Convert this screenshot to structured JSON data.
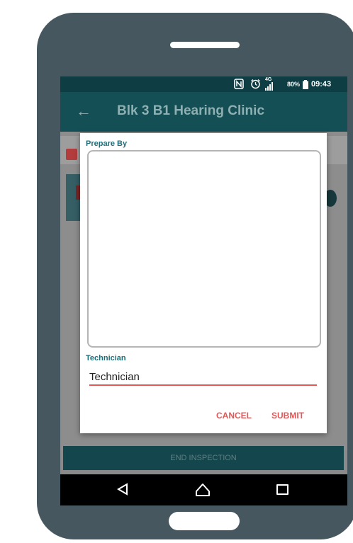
{
  "status_bar": {
    "nfc_icon": "nfc-icon",
    "alarm_icon": "alarm-icon",
    "network": "4G",
    "battery_pct": "80%",
    "time": "09:43"
  },
  "app_bar": {
    "back_glyph": "←",
    "title": "Blk 3 B1 Hearing Clinic"
  },
  "dialog": {
    "prepare_by_label": "Prepare By",
    "prepare_by_value": "",
    "technician_label": "Technician",
    "technician_value": "Technician",
    "cancel_label": "CANCEL",
    "submit_label": "SUBMIT"
  },
  "background": {
    "end_inspection_label": "END INSPECTION"
  },
  "colors": {
    "primary": "#134f55",
    "status_bar": "#0e3d43",
    "accent": "#e05858",
    "label": "#1c6f7a"
  }
}
